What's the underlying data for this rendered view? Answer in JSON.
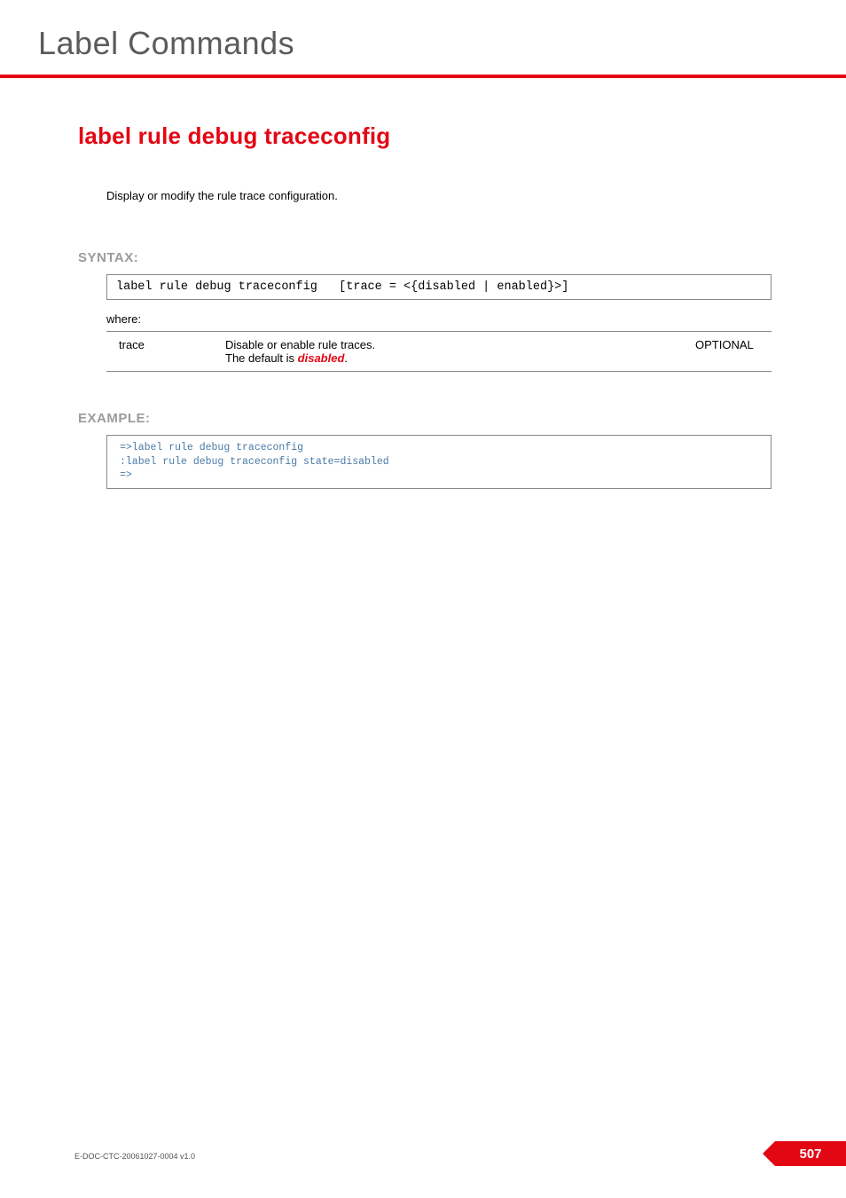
{
  "chapter_title": "Label Commands",
  "command": {
    "title": "label rule debug traceconfig",
    "description": "Display or modify the rule trace configuration."
  },
  "syntax": {
    "label": "SYNTAX:",
    "code": "label rule debug traceconfig   [trace = <{disabled | enabled}>]",
    "where_label": "where:",
    "params": [
      {
        "name": "trace",
        "desc_prefix": "Disable or enable rule traces.",
        "default_prefix": "The default is ",
        "default_value": "disabled",
        "default_suffix": ".",
        "requirement": "OPTIONAL"
      }
    ]
  },
  "example": {
    "label": "EXAMPLE:",
    "code": "=>label rule debug traceconfig\n:label rule debug traceconfig state=disabled\n=>"
  },
  "footer": {
    "doc_id": "E-DOC-CTC-20061027-0004 v1.0",
    "page_number": "507"
  }
}
